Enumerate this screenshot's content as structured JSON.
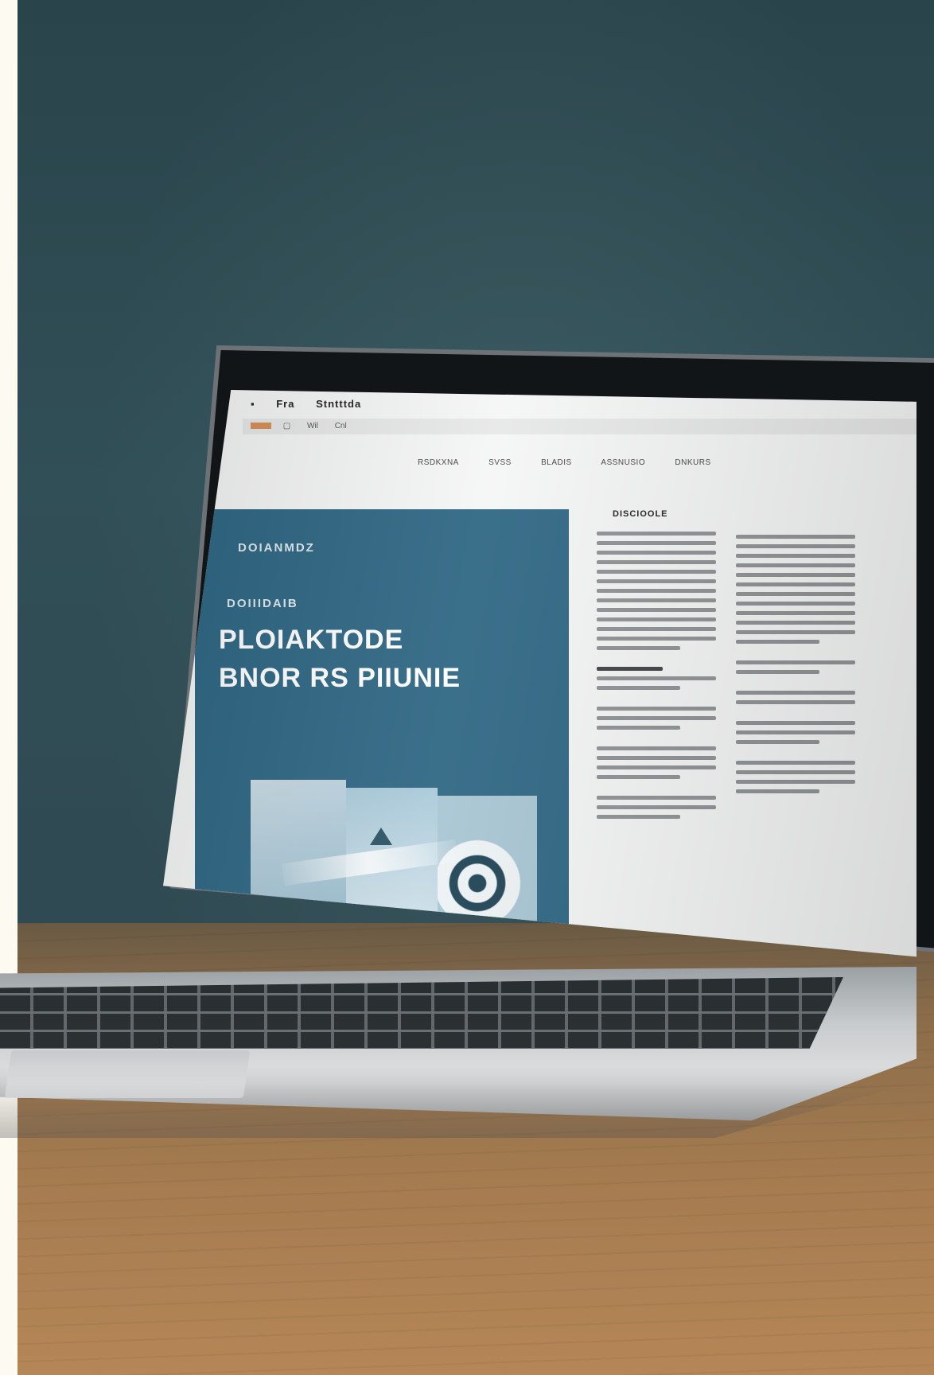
{
  "screen": {
    "titlebar": [
      "Fra",
      "Stntttda"
    ],
    "toolbar": [
      "Wil",
      "Cnl"
    ],
    "nav": [
      "RSDKXNA",
      "SVSS",
      "BLADIS",
      "ASSNUSIO",
      "DNKURS"
    ],
    "hero": {
      "kicker": "DOIANMDZ",
      "eyebrow": "DOIIIDAIB",
      "title_line1": "PLOIAKTODE",
      "title_line2": "BNOR RS PIIUNIE"
    },
    "side_heading": "DISCIOOLE"
  },
  "colors": {
    "hero": "#2f6784",
    "wall": "#2f4a52",
    "desk": "#a47b4f"
  }
}
